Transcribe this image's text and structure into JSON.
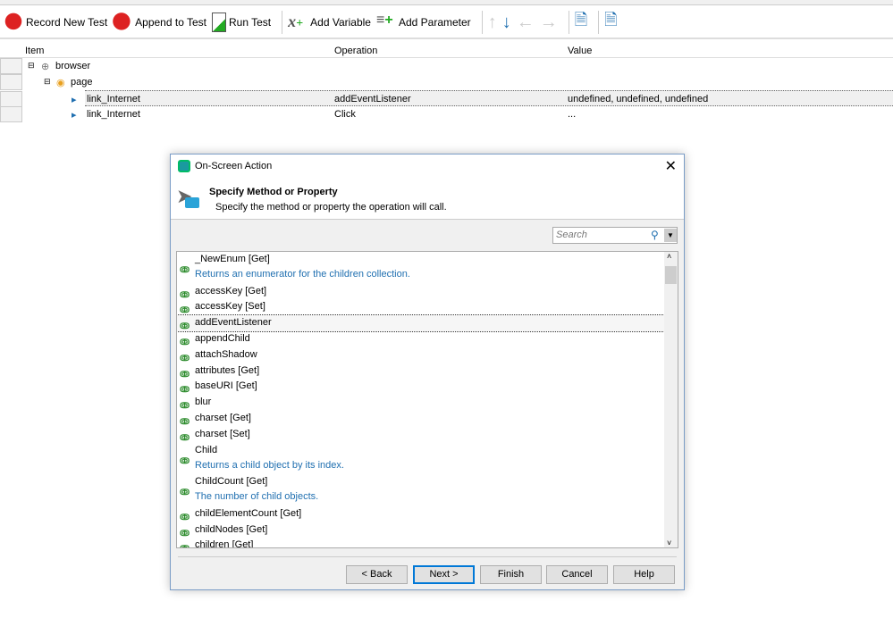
{
  "toolbar": {
    "record": "Record New Test",
    "append": "Append to Test",
    "run": "Run Test",
    "add_variable": "Add Variable",
    "add_parameter": "Add Parameter"
  },
  "grid": {
    "headers": {
      "item": "Item",
      "operation": "Operation",
      "value": "Value"
    },
    "rows": [
      {
        "item": "browser",
        "operation": "",
        "value": ""
      },
      {
        "item": "page",
        "operation": "",
        "value": ""
      },
      {
        "item": "link_Internet",
        "operation": "addEventListener",
        "value": "undefined, undefined, undefined"
      },
      {
        "item": "link_Internet",
        "operation": "Click",
        "value": "..."
      }
    ]
  },
  "dialog": {
    "title": "On-Screen Action",
    "heading": "Specify Method or Property",
    "subheading": "Specify the method or property the operation will call.",
    "search_placeholder": "Search",
    "items": [
      {
        "name": "_NewEnum [Get]",
        "desc": "Returns an enumerator for the children collection."
      },
      {
        "name": "accessKey [Get]"
      },
      {
        "name": "accessKey [Set]"
      },
      {
        "name": "addEventListener",
        "selected": true
      },
      {
        "name": "appendChild"
      },
      {
        "name": "attachShadow"
      },
      {
        "name": "attributes [Get]"
      },
      {
        "name": "baseURI [Get]"
      },
      {
        "name": "blur"
      },
      {
        "name": "charset [Get]"
      },
      {
        "name": "charset [Set]"
      },
      {
        "name": "Child",
        "desc": "Returns a child object by its index."
      },
      {
        "name": "ChildCount [Get]",
        "desc": "The number of child objects."
      },
      {
        "name": "childElementCount [Get]"
      },
      {
        "name": "childNodes [Get]"
      },
      {
        "name": "children [Get]"
      }
    ],
    "buttons": {
      "back": "< Back",
      "next": "Next >",
      "finish": "Finish",
      "cancel": "Cancel",
      "help": "Help"
    }
  }
}
